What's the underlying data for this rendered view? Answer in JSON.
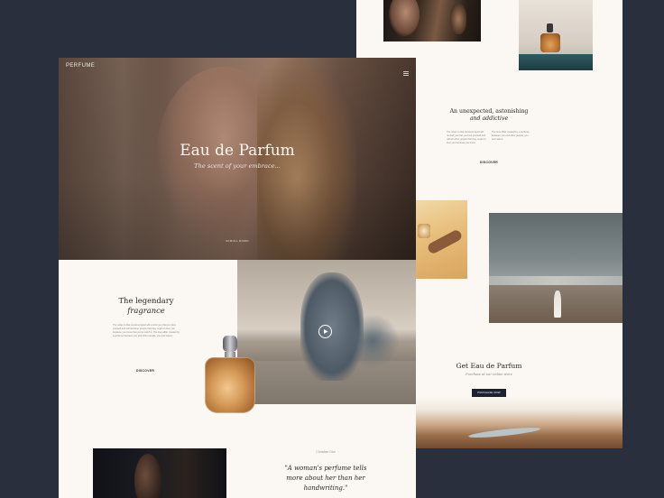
{
  "hero": {
    "brand": "PERFUME",
    "title": "Eau de Parfum",
    "subtitle": "The scent of your embrace...",
    "scroll_label": "SCROLL DOWN"
  },
  "legendary": {
    "title": "The legendary",
    "title_italic": "fragrance",
    "body": "The notes in that precious liquid will remind you that you love yourself and will tell other people that they ought to love you because you know that you're worth it. The love affair created by a perfume between you and other people, you and nature.",
    "link": "DISCOVER"
  },
  "unexpected": {
    "title": "An unexpected, astonishing",
    "title_italic": "and addictive",
    "col1": "The notes in that precious liquid will remind you that you love yourself and will tell other people that they ought to love you because you know.",
    "col2": "The love affair created by a perfume between you and other people, you and nature.",
    "link": "DISCOVER"
  },
  "get": {
    "title": "Get Eau de Parfum",
    "subtitle": "Purchase at our online store",
    "button": "PURCHASE NOW"
  },
  "quote": {
    "author": "Christian Dior",
    "text_l1": "\"A woman's perfume tells",
    "text_l2": "more about her than her",
    "text_l3": "handwriting.\""
  },
  "colors": {
    "background": "#2a2f3d",
    "page": "#fbf8f3",
    "button": "#1c2230"
  },
  "icons": {
    "menu": "menu-icon",
    "play": "play-icon"
  }
}
